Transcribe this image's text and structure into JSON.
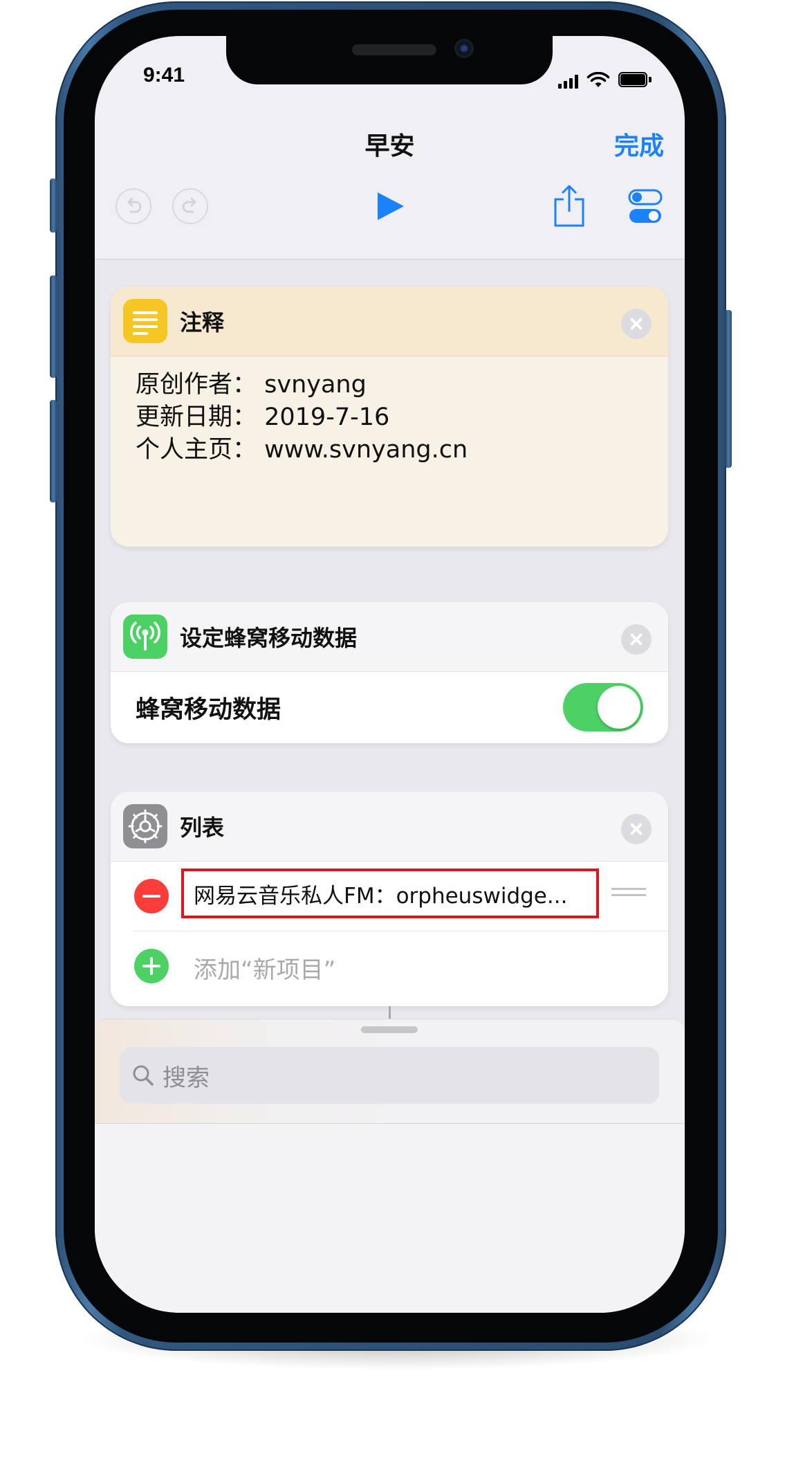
{
  "status_bar": {
    "time": "9:41"
  },
  "nav": {
    "title": "早安",
    "done_label": "完成"
  },
  "toolbar": {
    "undo_icon": "undo-arrow",
    "redo_icon": "redo-arrow",
    "play_icon": "play-triangle",
    "share_icon": "share-box-arrow",
    "settings_icon": "toggles"
  },
  "comment_card": {
    "title": "注释",
    "lines": [
      "原创作者：  svnyang",
      "更新日期：  2019-7-16",
      "个人主页：  www.svnyang.cn"
    ],
    "icon_color": "#f5c624"
  },
  "cellular_card": {
    "title": "设定蜂窝移动数据",
    "row_label": "蜂窝移动数据",
    "toggle_on": true,
    "icon_color": "#4cd164"
  },
  "list_card": {
    "title": "列表",
    "items": [
      {
        "text": "网易云音乐私人FM：orpheuswidge..."
      }
    ],
    "add_label": "添加“新项目”"
  },
  "search": {
    "placeholder": "搜索"
  },
  "colors": {
    "accent": "#1a82fb",
    "destructive": "#fc3d39",
    "positive": "#4cd164",
    "highlight_box": "#e0141e"
  }
}
